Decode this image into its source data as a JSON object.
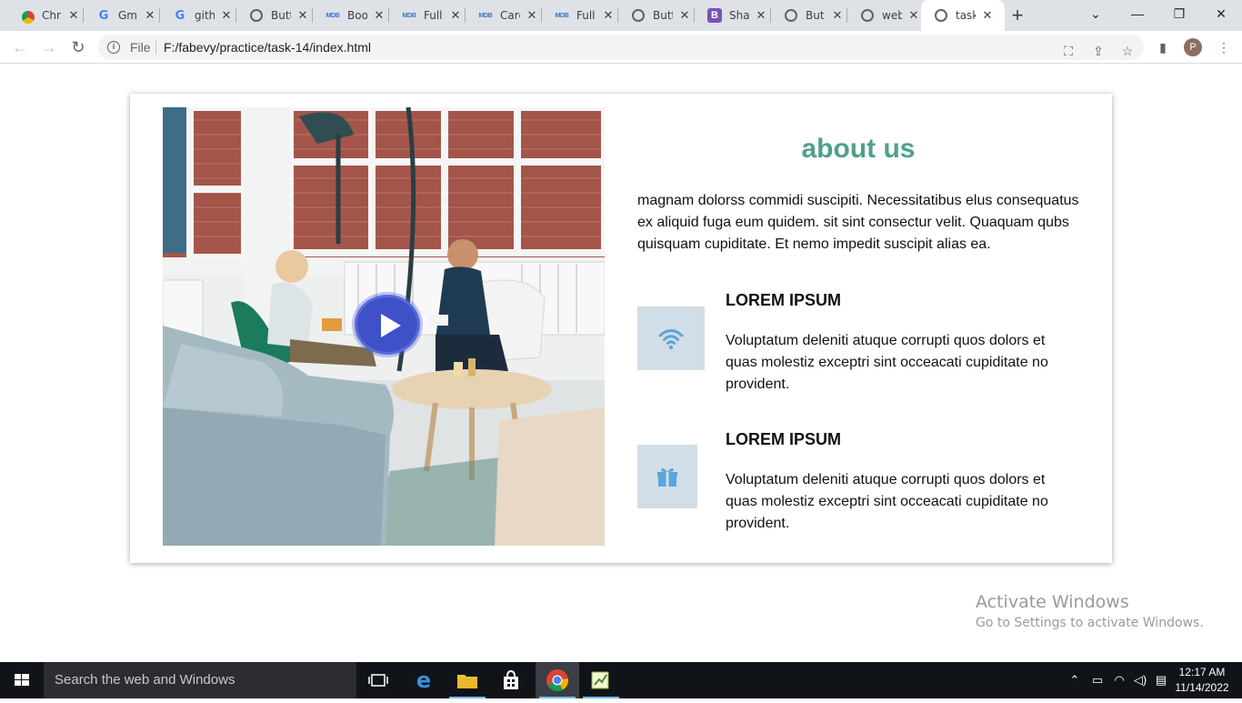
{
  "browser": {
    "tabs": [
      {
        "favicon": "chrome-icon",
        "title": "Chr"
      },
      {
        "favicon": "google-icon",
        "title": "Gm"
      },
      {
        "favicon": "google-icon",
        "title": "gith"
      },
      {
        "favicon": "globe-icon",
        "title": "Butt"
      },
      {
        "favicon": "mdb-icon",
        "title": "Boo"
      },
      {
        "favicon": "mdb-icon",
        "title": "Full"
      },
      {
        "favicon": "mdb-icon",
        "title": "Card"
      },
      {
        "favicon": "mdb-icon",
        "title": "Full"
      },
      {
        "favicon": "globe-icon",
        "title": "Butt"
      },
      {
        "favicon": "bootstrap-icon",
        "title": "Sha"
      },
      {
        "favicon": "globe-icon",
        "title": "But"
      },
      {
        "favicon": "globe-icon",
        "title": "web"
      },
      {
        "favicon": "globe-icon",
        "title": "task"
      }
    ],
    "active_tab_index": 12,
    "favicon_labels": {
      "google": "G",
      "mdb": "MDB",
      "bootstrap": "B"
    },
    "address": {
      "scheme_label": "File",
      "url": "F:/fabevy/practice/task-14/index.html"
    },
    "profile_initial": "P"
  },
  "page": {
    "title": "about us",
    "intro": "magnam dolorss commidi suscipiti. Necessitatibus elus consequatus ex aliquid fuga eum quidem. sit sint consectur velit. Quaquam qubs quisquam cupiditate. Et nemo impedit suscipit alias ea.",
    "features": [
      {
        "icon": "wifi-icon",
        "title": "LOREM IPSUM",
        "text": "Voluptatum deleniti atuque corrupti quos dolors et quas molestiz exceptri sint occeacati cupiditate no provident."
      },
      {
        "icon": "gift-icon",
        "title": "LOREM IPSUM",
        "text": "Voluptatum deleniti atuque corrupti quos dolors et quas molestiz exceptri sint occeacati cupiditate no provident."
      }
    ],
    "colors": {
      "title": "#4fa08b",
      "icon_box": "#d2dee7",
      "icon": "#5aa6d9",
      "play_button": "#3f51c8"
    }
  },
  "watermark": {
    "line1": "Activate Windows",
    "line2": "Go to Settings to activate Windows."
  },
  "taskbar": {
    "search_placeholder": "Search the web and Windows",
    "apps": [
      "task-view-icon",
      "edge-icon",
      "file-explorer-icon",
      "store-icon",
      "chrome-icon",
      "app-icon"
    ],
    "time": "12:17 AM",
    "date": "11/14/2022"
  }
}
